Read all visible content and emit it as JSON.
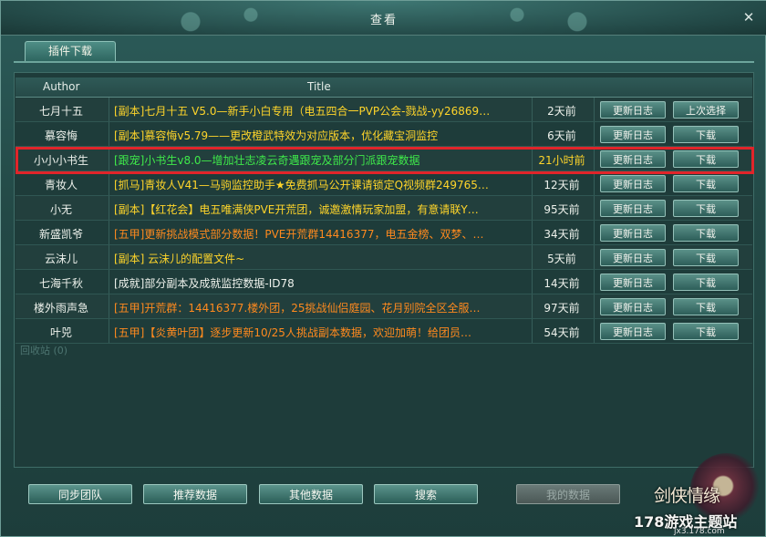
{
  "window": {
    "title": "查看",
    "close_glyph": "✕"
  },
  "tabs": [
    {
      "label": "插件下载"
    }
  ],
  "table": {
    "headers": {
      "author": "Author",
      "title": "Title"
    },
    "rows": [
      {
        "author": "七月十五",
        "title": "[副本]七月十五 V5.0—新手小白专用（电五四合一PVP公会-戮战-yy26869…",
        "time": "2天前",
        "log": "更新日志",
        "action": "上次选择",
        "color": "#ffd52a"
      },
      {
        "author": "慕容悔",
        "title": "[副本]慕容悔v5.79——更改橙武特效为对应版本，优化藏宝洞监控",
        "time": "6天前",
        "log": "更新日志",
        "action": "下载",
        "color": "#ffd52a"
      },
      {
        "author": "小小小书生",
        "title": "[跟宠]小书生v8.0—增加壮志凌云奇遇跟宠及部分门派跟宠数据",
        "time": "21小时前",
        "log": "更新日志",
        "action": "下载",
        "color": "#3fea4a"
      },
      {
        "author": "青妆人",
        "title": "[抓马]青妆人V41—马驹监控助手★免费抓马公开课请锁定Q视频群249765…",
        "time": "12天前",
        "log": "更新日志",
        "action": "下载",
        "color": "#ffd52a"
      },
      {
        "author": "小无",
        "title": "[副本]【红花会】电五唯满侠PVE开荒团，诚邀激情玩家加盟，有意请联Y…",
        "time": "95天前",
        "log": "更新日志",
        "action": "下载",
        "color": "#ffd52a"
      },
      {
        "author": "新盛凯爷",
        "title": "[五甲]更新挑战模式部分数据！PVE开荒群14416377，电五金榜、双梦、…",
        "time": "34天前",
        "log": "更新日志",
        "action": "下载",
        "color": "#ff8a1e"
      },
      {
        "author": "云沫儿",
        "title": "[副本] 云沫儿的配置文件~",
        "time": "5天前",
        "log": "更新日志",
        "action": "下载",
        "color": "#ffd52a"
      },
      {
        "author": "七海千秋",
        "title": "[成就]部分副本及成就监控数据-ID78",
        "time": "14天前",
        "log": "更新日志",
        "action": "下载",
        "color": "#eef2ec"
      },
      {
        "author": "楼外雨声急",
        "title": "[五甲]开荒群：14416377.楼外团，25挑战仙侣庭园、花月别院全区全服…",
        "time": "97天前",
        "log": "更新日志",
        "action": "下载",
        "color": "#ff8a1e"
      },
      {
        "author": "叶兕",
        "title": "[五甲]【炎黄叶团】逐步更新10/25人挑战副本数据，欢迎加萌！给团员…",
        "time": "54天前",
        "log": "更新日志",
        "action": "下载",
        "color": "#ff8a1e"
      }
    ]
  },
  "ghost": {
    "recycle": "回收站 (0)"
  },
  "bottom_buttons": [
    {
      "label": "同步团队",
      "enabled": true
    },
    {
      "label": "推荐数据",
      "enabled": true
    },
    {
      "label": "其他数据",
      "enabled": true
    },
    {
      "label": "搜索",
      "enabled": true
    },
    {
      "label": "我的数据",
      "enabled": false
    }
  ],
  "watermark": {
    "logo_text": "剑侠情缘",
    "site_name": "178游戏主题站",
    "site_url": "jx3.178.com"
  },
  "colors": {
    "highlight_border": "#e0252a",
    "accent_teal": "#2e6660"
  }
}
